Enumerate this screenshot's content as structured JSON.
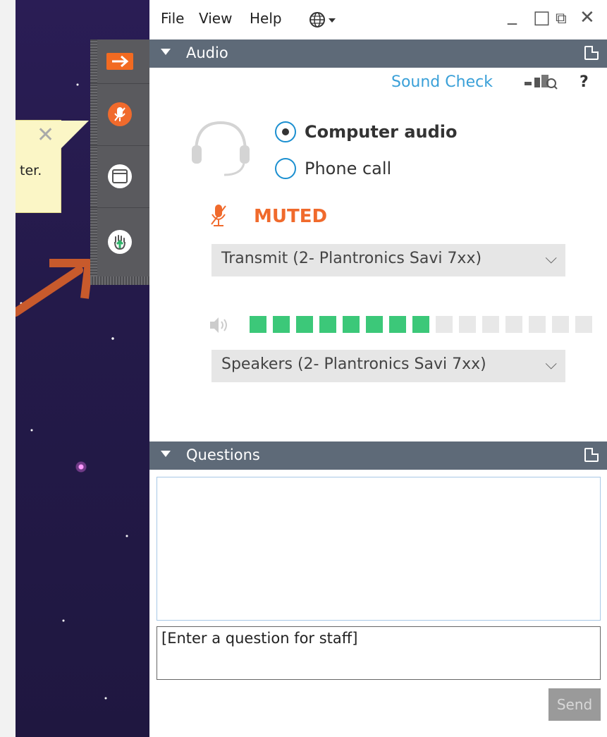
{
  "menubar": {
    "file": "File",
    "view": "View",
    "help": "Help",
    "globe_icon": "globe-icon",
    "minimize": "_",
    "restore": "□",
    "popout": "⧉",
    "close": "✕"
  },
  "tooltip": {
    "text": "ter.",
    "close": "✕"
  },
  "audio": {
    "header": "Audio",
    "sound_check": "Sound Check",
    "help": "?",
    "computer_audio": "Computer audio",
    "phone_call": "Phone call",
    "muted": "MUTED",
    "transmit_device": "Transmit (2- Plantronics Savi 7xx)",
    "speakers_device": "Speakers (2- Plantronics Savi 7xx)",
    "volume_level": 0.53,
    "volume_total_bars": 15,
    "volume_active_bars": 8
  },
  "questions": {
    "header": "Questions",
    "input_placeholder": "[Enter a question for staff]",
    "send": "Send"
  },
  "colors": {
    "header_bg": "#5e6a78",
    "accent_orange": "#f06a2c",
    "link_blue": "#3aa0d8",
    "volume_green": "#3cc879",
    "volume_off": "#e8e8e8"
  }
}
